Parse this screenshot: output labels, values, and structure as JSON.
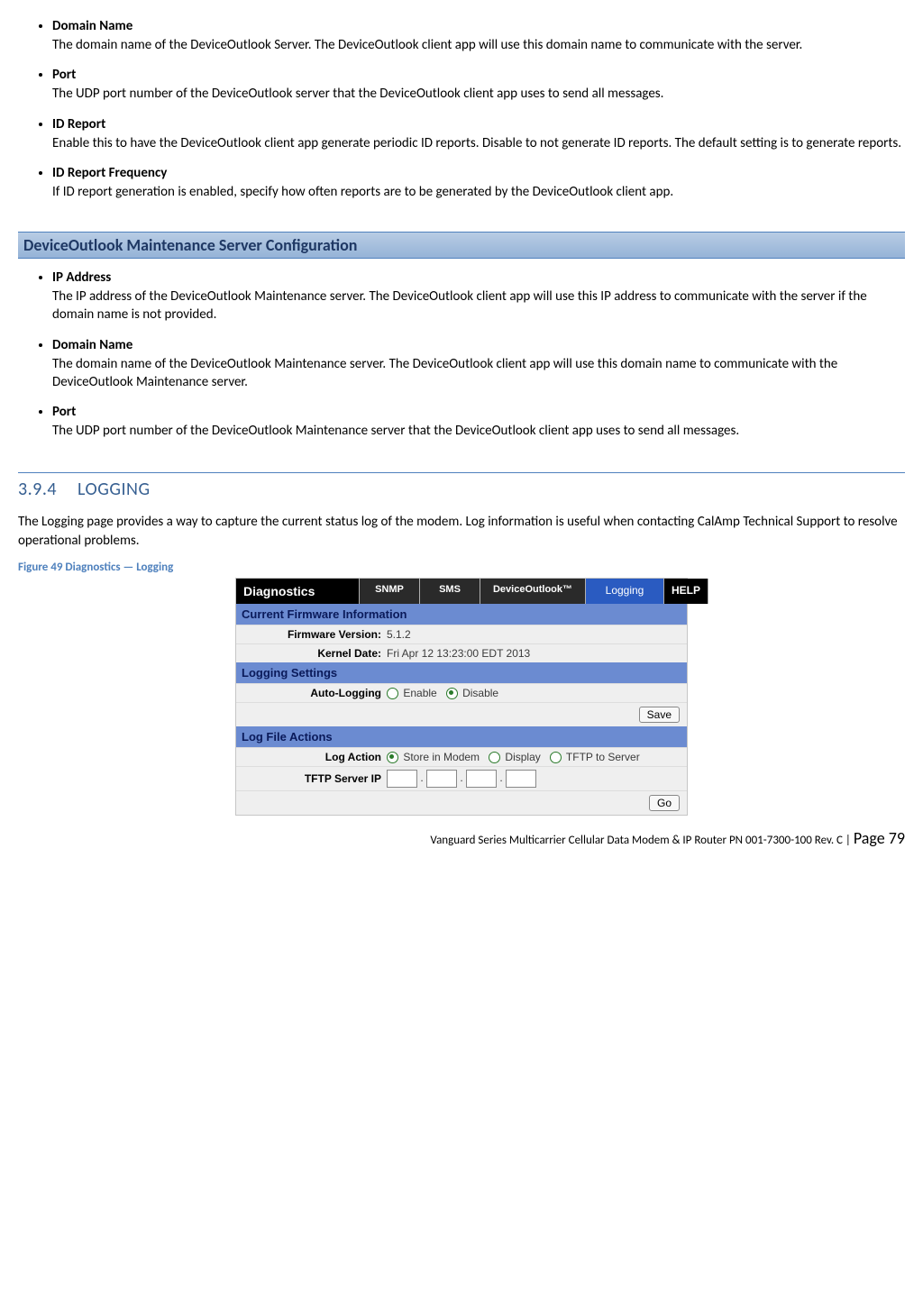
{
  "list1": [
    {
      "term": "Domain Name",
      "desc": "The domain name of the DeviceOutlook Server. The DeviceOutlook client app will use this domain name to communicate with the server."
    },
    {
      "term": "Port",
      "desc": "The UDP port number of the DeviceOutlook server that the DeviceOutlook client app uses to send all messages."
    },
    {
      "term": "ID Report",
      "desc": "Enable this to have the DeviceOutlook client app generate periodic ID reports. Disable to not generate ID reports. The default setting is to generate reports."
    },
    {
      "term": "ID Report Frequency",
      "desc": "If ID report generation is enabled, specify how often reports are to be generated by the DeviceOutlook client app."
    }
  ],
  "section_bar": "DeviceOutlook Maintenance Server Configuration",
  "list2": [
    {
      "term": "IP Address",
      "desc": "The IP address of the DeviceOutlook Maintenance server. The DeviceOutlook client app will use this IP address to communicate with the server if the domain name is not provided."
    },
    {
      "term": "Domain Name",
      "desc": "The domain name of the DeviceOutlook Maintenance server. The DeviceOutlook client app will use this domain name to communicate with the DeviceOutlook Maintenance server."
    },
    {
      "term": "Port",
      "desc": "The UDP port number of the DeviceOutlook Maintenance server that the DeviceOutlook client app uses to send all messages."
    }
  ],
  "h394_num": "3.9.4",
  "h394_title": "LOGGING",
  "logging_para": "The Logging page provides a way to capture the current status log of the modem. Log information is useful when contacting CalAmp Technical Support to resolve operational problems.",
  "fig_cap": "Figure 49 Diagnostics — Logging",
  "shot": {
    "tabs": {
      "main": "Diagnostics",
      "snmp": "SNMP",
      "sms": "SMS",
      "dov": "DeviceOutlook™",
      "logging": "Logging",
      "help": "HELP"
    },
    "sect1": "Current Firmware Information",
    "fw_label": "Firmware Version:",
    "fw_val": "5.1.2",
    "kd_label": "Kernel Date:",
    "kd_val": "Fri Apr 12 13:23:00 EDT 2013",
    "sect2": "Logging Settings",
    "auto_label": "Auto-Logging",
    "enable": "Enable",
    "disable": "Disable",
    "save": "Save",
    "sect3": "Log File Actions",
    "logact_label": "Log Action",
    "store": "Store in Modem",
    "display": "Display",
    "tftp": "TFTP to Server",
    "tftp_label": "TFTP Server IP",
    "go": "Go"
  },
  "footer_pre": "Vanguard Series Multicarrier Cellular Data Modem & IP Router PN 001-7300-100 Rev. C | ",
  "footer_page_word": "Page ",
  "footer_page_num": "79"
}
